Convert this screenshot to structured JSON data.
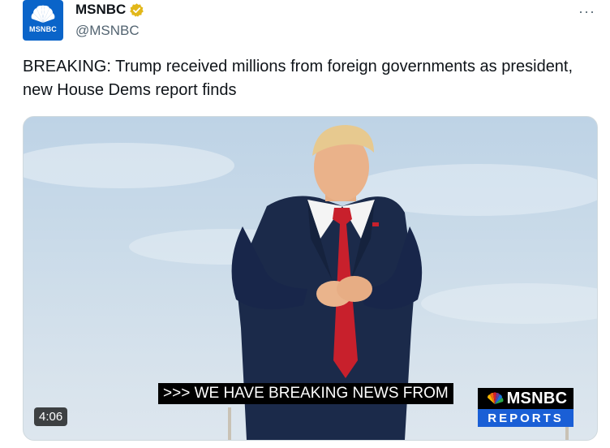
{
  "account": {
    "display_name": "MSNBC",
    "handle": "@MSNBC",
    "avatar_text": "MSNBC"
  },
  "more_label": "···",
  "tweet": {
    "text": "BREAKING: Trump received millions from foreign governments as president, new House Dems report finds"
  },
  "video": {
    "caption": ">>> WE HAVE BREAKING NEWS FROM",
    "logo_top": "MSNBC",
    "logo_bottom": "REPORTS",
    "duration": "4:06"
  },
  "colors": {
    "avatar_bg": "#0a64c9",
    "verified_badge": "#e2b719",
    "reports_blue": "#1a5fd6"
  },
  "icons": [
    "peacock-logo-icon",
    "verified-badge-icon",
    "more-icon"
  ]
}
